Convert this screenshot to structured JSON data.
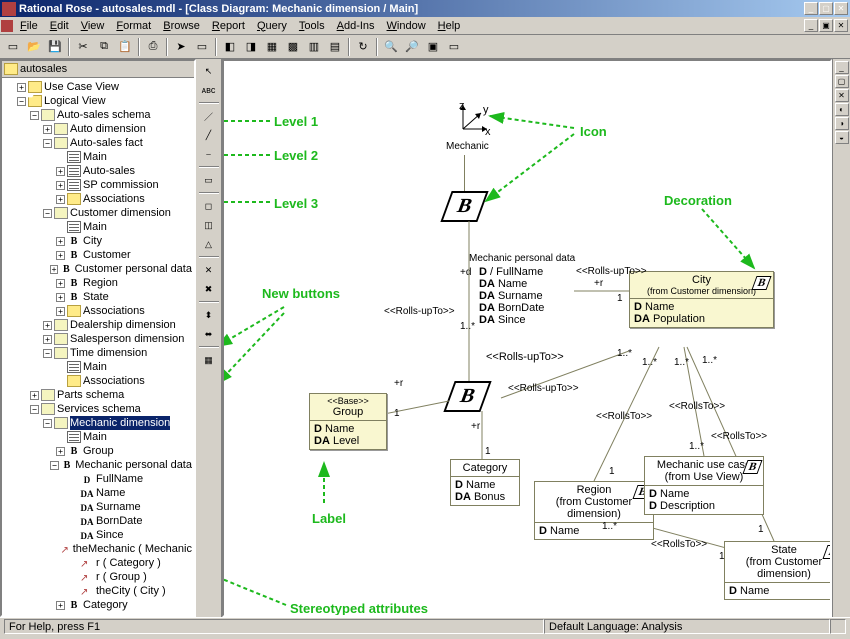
{
  "titlebar": {
    "text": "Rational Rose - autosales.mdl - [Class Diagram: Mechanic dimension / Main]"
  },
  "menu": [
    "File",
    "Edit",
    "View",
    "Format",
    "Browse",
    "Report",
    "Query",
    "Tools",
    "Add-Ins",
    "Window",
    "Help"
  ],
  "toolbar_icons": [
    "new",
    "open",
    "save",
    "|",
    "cut",
    "copy",
    "paste",
    "|",
    "print",
    "|",
    "arrow",
    "box",
    "|",
    "a1",
    "a2",
    "a3",
    "a4",
    "a5",
    "a6",
    "|",
    "reload",
    "|",
    "zin",
    "zout",
    "fit",
    "win"
  ],
  "palette_icons": [
    "pointer",
    "abc",
    "|",
    "line1",
    "line2",
    "line3",
    "|",
    "box",
    "|",
    "open",
    "new",
    "gen",
    "|",
    "x1",
    "x2",
    "|",
    "x3",
    "x4",
    "|",
    "gr"
  ],
  "sidebar_icons": [
    "min",
    "max",
    "close",
    "tab1",
    "tab2",
    "tab3"
  ],
  "tree_root": "autosales",
  "tree": [
    {
      "d": 0,
      "e": "+",
      "i": "folder",
      "t": "Use Case View"
    },
    {
      "d": 0,
      "e": "-",
      "i": "folder-open",
      "t": "Logical View"
    },
    {
      "d": 1,
      "e": "-",
      "i": "class",
      "t": "Auto-sales schema"
    },
    {
      "d": 2,
      "e": "+",
      "i": "class",
      "t": "Auto dimension"
    },
    {
      "d": 2,
      "e": "-",
      "i": "class",
      "t": "Auto-sales fact"
    },
    {
      "d": 3,
      "e": "",
      "i": "diag",
      "t": "Main"
    },
    {
      "d": 3,
      "e": "+",
      "i": "diag",
      "t": "Auto-sales"
    },
    {
      "d": 3,
      "e": "+",
      "i": "diag",
      "t": "SP commission"
    },
    {
      "d": 3,
      "e": "+",
      "i": "folder",
      "t": "Associations"
    },
    {
      "d": 2,
      "e": "-",
      "i": "class",
      "t": "Customer dimension"
    },
    {
      "d": 3,
      "e": "",
      "i": "diag",
      "t": "Main"
    },
    {
      "d": 3,
      "e": "+",
      "i": "battr",
      "t": "City",
      "ico": "B"
    },
    {
      "d": 3,
      "e": "+",
      "i": "battr",
      "t": "Customer",
      "ico": "B"
    },
    {
      "d": 3,
      "e": "+",
      "i": "battr",
      "t": "Customer personal data",
      "ico": "B"
    },
    {
      "d": 3,
      "e": "+",
      "i": "battr",
      "t": "Region",
      "ico": "B"
    },
    {
      "d": 3,
      "e": "+",
      "i": "battr",
      "t": "State",
      "ico": "B"
    },
    {
      "d": 3,
      "e": "+",
      "i": "folder",
      "t": "Associations"
    },
    {
      "d": 2,
      "e": "+",
      "i": "class",
      "t": "Dealership dimension"
    },
    {
      "d": 2,
      "e": "+",
      "i": "class",
      "t": "Salesperson dimension"
    },
    {
      "d": 2,
      "e": "-",
      "i": "class",
      "t": "Time dimension"
    },
    {
      "d": 3,
      "e": "",
      "i": "diag",
      "t": "Main"
    },
    {
      "d": 3,
      "e": "",
      "i": "folder",
      "t": "Associations"
    },
    {
      "d": 1,
      "e": "+",
      "i": "class",
      "t": "Parts schema"
    },
    {
      "d": 1,
      "e": "-",
      "i": "class",
      "t": "Services schema"
    },
    {
      "d": 2,
      "e": "-",
      "i": "class",
      "t": "Mechanic dimension",
      "sel": true
    },
    {
      "d": 3,
      "e": "",
      "i": "diag",
      "t": "Main"
    },
    {
      "d": 3,
      "e": "+",
      "i": "battr",
      "t": "Group",
      "ico": "B"
    },
    {
      "d": 3,
      "e": "-",
      "i": "battr",
      "t": "Mechanic personal data",
      "ico": "B"
    },
    {
      "d": 4,
      "e": "",
      "i": "dattr",
      "t": "FullName",
      "ico": "D"
    },
    {
      "d": 4,
      "e": "",
      "i": "dattr",
      "t": "Name",
      "ico": "DA"
    },
    {
      "d": 4,
      "e": "",
      "i": "dattr",
      "t": "Surname",
      "ico": "DA"
    },
    {
      "d": 4,
      "e": "",
      "i": "dattr",
      "t": "BornDate",
      "ico": "DA"
    },
    {
      "d": 4,
      "e": "",
      "i": "dattr",
      "t": "Since",
      "ico": "DA"
    },
    {
      "d": 4,
      "e": "",
      "i": "assoc",
      "t": "theMechanic ( Mechanic"
    },
    {
      "d": 4,
      "e": "",
      "i": "assoc",
      "t": "r ( Category )"
    },
    {
      "d": 4,
      "e": "",
      "i": "assoc",
      "t": "r ( Group )"
    },
    {
      "d": 4,
      "e": "",
      "i": "assoc",
      "t": "theCity ( City )"
    },
    {
      "d": 3,
      "e": "+",
      "i": "battr",
      "t": "Category",
      "ico": "B"
    }
  ],
  "canvas": {
    "mechanic_label": "Mechanic",
    "personal": {
      "title": "Mechanic personal data",
      "attrs": [
        "D / FullName",
        "DA Name",
        "DA Surname",
        "DA BornDate",
        "DA Since"
      ]
    },
    "group": {
      "stereo": "<<Base>>",
      "name": "Group",
      "attrs": [
        "D Name",
        "DA Level"
      ]
    },
    "city": {
      "name": "City",
      "from": "(from Customer dimension)",
      "attrs": [
        "D Name",
        "DA Population"
      ]
    },
    "category": {
      "name": "Category",
      "attrs": [
        "D Name",
        "DA Bonus"
      ]
    },
    "region": {
      "name": "Region",
      "from": "(from Customer dimension)",
      "attrs": [
        "D Name"
      ]
    },
    "mechanic_usec": {
      "name": "Mechanic use case",
      "from": "(from Use View)",
      "attrs": [
        "D Name",
        "D Description"
      ]
    },
    "state": {
      "name": "State",
      "from": "(from Customer dimension)",
      "attrs": [
        "D Name"
      ]
    },
    "rel_rollsup": "<<Rolls-upTo>>",
    "rel_rollsto": "<<RollsTo>>",
    "role_d": "+d",
    "role_r": "+r",
    "mult_1": "1",
    "mult_1s": "1..*",
    "annot": {
      "l1": "Level 1",
      "l2": "Level 2",
      "l3": "Level 3",
      "icon": "Icon",
      "deco": "Decoration",
      "newbtn": "New buttons",
      "label": "Label",
      "stereo": "Stereotyped attributes"
    }
  },
  "status": {
    "left": "For Help, press F1",
    "right": "Default Language: Analysis"
  }
}
